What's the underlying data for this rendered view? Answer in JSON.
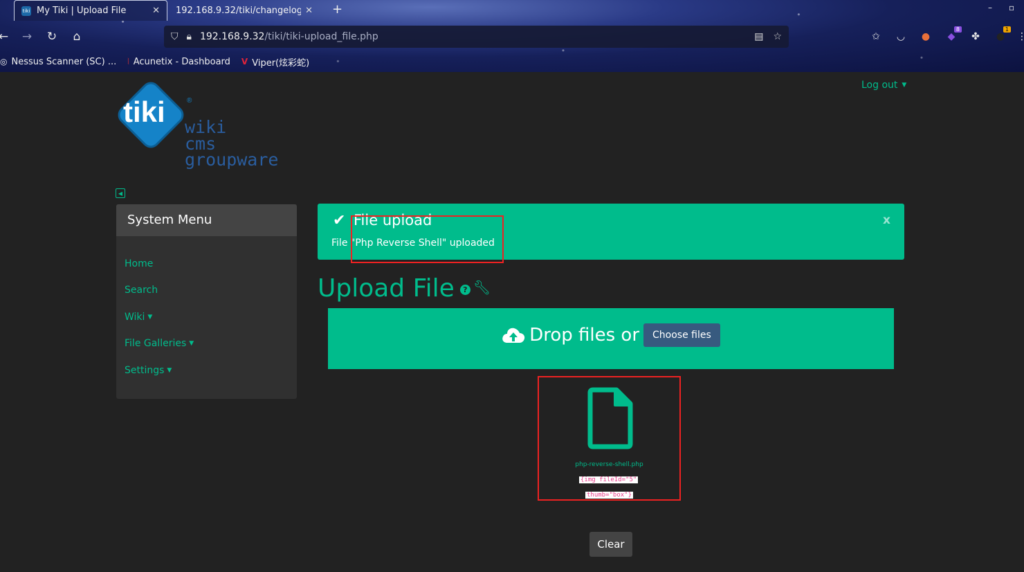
{
  "browser": {
    "tabs": [
      {
        "title": "My Tiki | Upload File",
        "favicon": "tiki-favicon"
      },
      {
        "title": "192.168.9.32/tiki/changelog.tx"
      }
    ],
    "url_host": "192.168.9.32",
    "url_path": "/tiki/tiki-upload_file.php",
    "bookmarks": [
      {
        "label": "Nessus Scanner (SC) ..."
      },
      {
        "label": "Acunetix - Dashboard"
      },
      {
        "label": "Viper(炫彩蛇)"
      }
    ],
    "badges": {
      "extension_count": "8",
      "notification_count": "1"
    }
  },
  "header": {
    "logout": "Log out",
    "logo_text": "tiki",
    "logo_lines": [
      "wiki",
      "cms",
      "groupware"
    ],
    "logo_reg": "®"
  },
  "sidebar": {
    "title": "System Menu",
    "items": [
      {
        "label": "Home"
      },
      {
        "label": "Search"
      },
      {
        "label": "Wiki",
        "dropdown": true
      },
      {
        "label": "File Galleries",
        "dropdown": true
      },
      {
        "label": "Settings",
        "dropdown": true
      }
    ]
  },
  "alert": {
    "title": "File upload",
    "message": "File \"Php Reverse Shell\" uploaded",
    "close": "x"
  },
  "page": {
    "title": "Upload File"
  },
  "dropzone": {
    "text": "Drop files or",
    "button": "Choose files"
  },
  "preview": {
    "filename": "php-reverse-shell.php",
    "code_line1": "{img fileId=\"5\"",
    "code_line2": "thumb=\"box\"}"
  },
  "actions": {
    "clear": "Clear"
  },
  "colors": {
    "accent": "#00bc8c",
    "background": "#222222",
    "panel": "#303030",
    "button_primary": "#375a7f",
    "highlight_box": "#ee2222"
  }
}
